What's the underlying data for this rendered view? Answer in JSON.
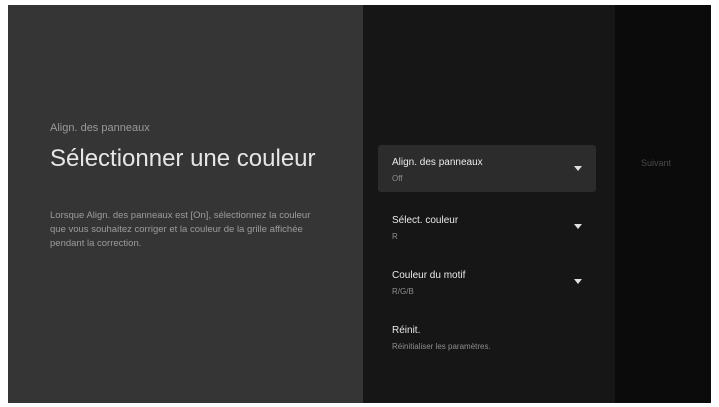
{
  "breadcrumb": "Align. des panneaux",
  "title": "Sélectionner une couleur",
  "description": "Lorsque Align. des panneaux est [On], sélectionnez la couleur que vous souhaitez corriger et la couleur de la grille affichée pendant la correction.",
  "menu": {
    "items": [
      {
        "label": "Align. des panneaux",
        "value": "Off",
        "has_dropdown": true,
        "focused": true
      },
      {
        "label": "Sélect. couleur",
        "value": "R",
        "has_dropdown": true,
        "focused": false
      },
      {
        "label": "Couleur du motif",
        "value": "R/G/B",
        "has_dropdown": true,
        "focused": false
      },
      {
        "label": "Réinit.",
        "value": "Réinitialiser les paramètres.",
        "has_dropdown": false,
        "focused": false
      }
    ]
  },
  "next_button": "Suivant",
  "colors": {
    "left_panel": "#353535",
    "middle_panel": "#161616",
    "right_panel": "#0b0b0b",
    "focused_item": "#2c2c2c"
  }
}
